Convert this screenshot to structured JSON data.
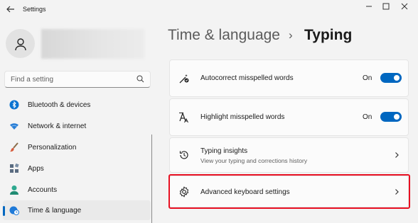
{
  "window": {
    "title": "Settings"
  },
  "search": {
    "placeholder": "Find a setting"
  },
  "nav": {
    "items": [
      {
        "label": "Bluetooth & devices",
        "icon": "bluetooth-icon"
      },
      {
        "label": "Network & internet",
        "icon": "wifi-icon"
      },
      {
        "label": "Personalization",
        "icon": "brush-icon"
      },
      {
        "label": "Apps",
        "icon": "apps-icon"
      },
      {
        "label": "Accounts",
        "icon": "person-icon"
      },
      {
        "label": "Time & language",
        "icon": "globe-clock-icon",
        "selected": true
      }
    ]
  },
  "header": {
    "breadcrumb_parent": "Time & language",
    "separator": "›",
    "current": "Typing"
  },
  "settings": [
    {
      "title": "Autocorrect misspelled words",
      "state": "On",
      "icon": "autocorrect-icon",
      "toggle_on": true
    },
    {
      "title": "Highlight misspelled words",
      "state": "On",
      "icon": "highlight-spelling-icon",
      "toggle_on": true
    },
    {
      "title": "Typing insights",
      "subtitle": "View your typing and corrections history",
      "icon": "history-icon"
    },
    {
      "title": "Advanced keyboard settings",
      "icon": "gear-icon",
      "highlighted": true
    }
  ],
  "colors": {
    "accent": "#0067c0",
    "highlight_border": "#e81123",
    "background": "#f3f3f3"
  }
}
